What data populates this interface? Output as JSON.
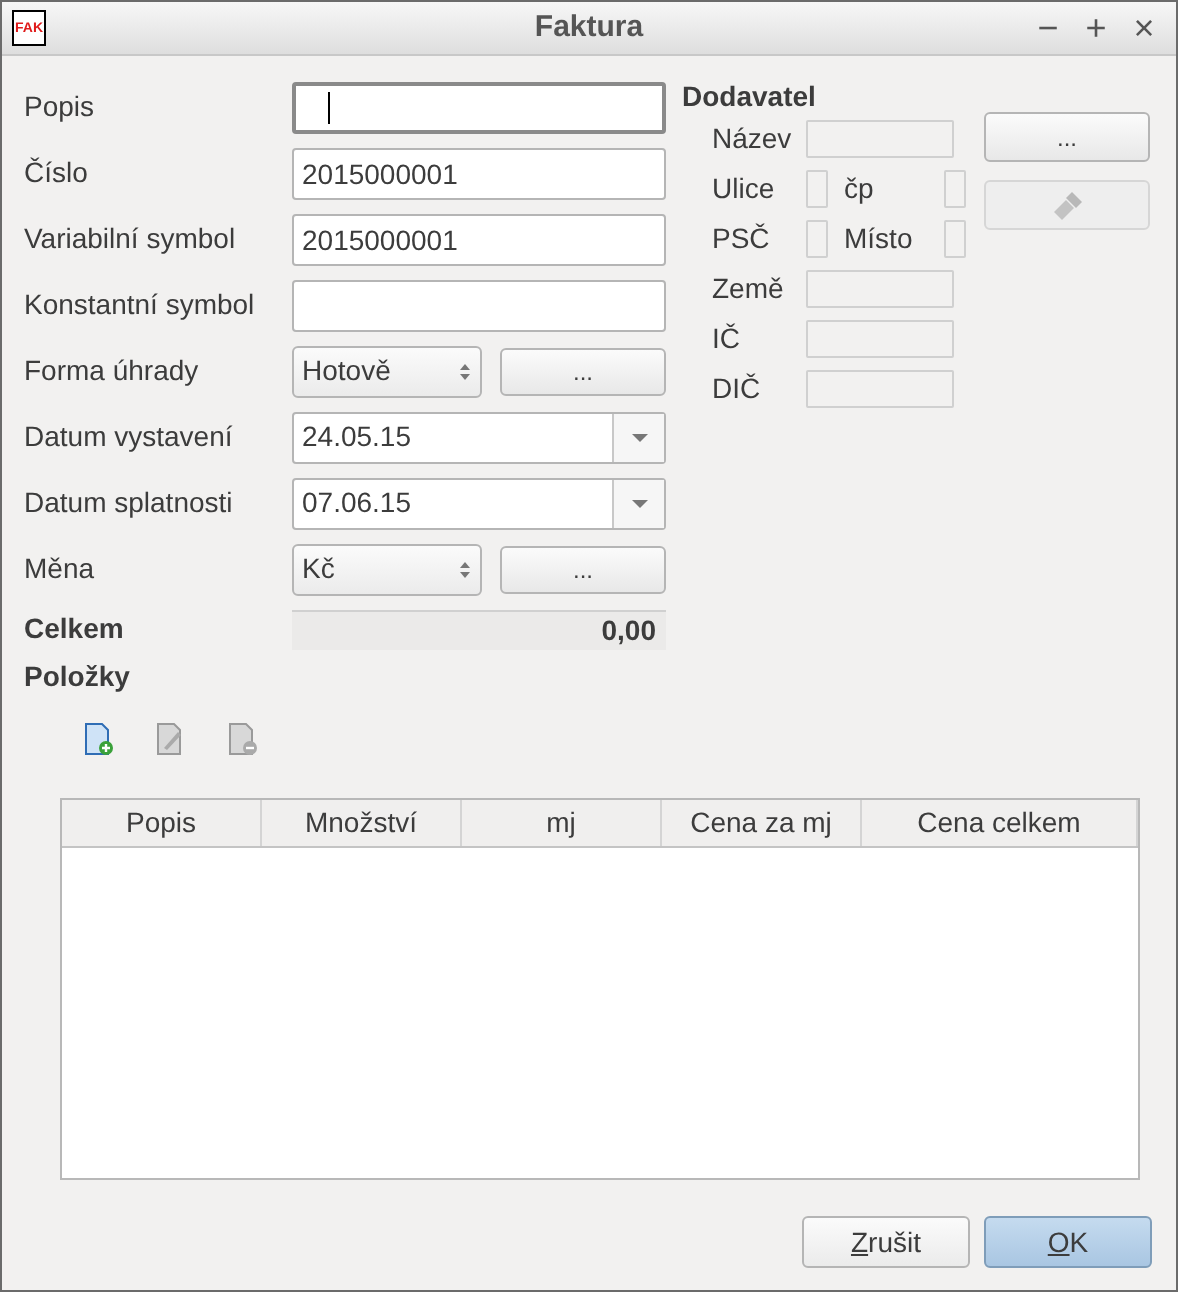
{
  "window": {
    "title": "Faktura",
    "app_icon_text": "FAK",
    "controls": [
      "−",
      "+",
      "×"
    ]
  },
  "form": [
    {
      "kind": "text",
      "label": "Popis",
      "focused": true
    },
    {
      "kind": "text",
      "label": "Číslo",
      "value": "2015000001",
      "focused": false
    },
    {
      "kind": "text",
      "label": "Variabilní symbol",
      "value": "2015000001",
      "focused": false
    },
    {
      "kind": "text",
      "label": "Konstantní symbol",
      "focused": false
    },
    {
      "kind": "combo",
      "label": "Forma úhrady",
      "value": "Hotově",
      "button": "..."
    },
    {
      "kind": "date",
      "label": "Datum vystavení",
      "value": "24.05.15"
    },
    {
      "kind": "date",
      "label": "Datum splatnosti",
      "value": "07.06.15"
    },
    {
      "kind": "combo",
      "label": "Měna",
      "value": "Kč",
      "button": "..."
    },
    {
      "kind": "total",
      "label": "Celkem",
      "value": "0,00"
    }
  ],
  "supplier": {
    "title": "Dodavatel",
    "rows": [
      {
        "kind": "single",
        "label": "Název"
      },
      {
        "kind": "pair",
        "label": "Ulice",
        "label_2": "čp"
      },
      {
        "kind": "pair",
        "label": "PSČ",
        "label_2": "Místo"
      },
      {
        "kind": "single",
        "label": "Země"
      },
      {
        "kind": "single",
        "label": "IČ"
      },
      {
        "kind": "single",
        "label": "DIČ"
      }
    ],
    "buttons": [
      {
        "kind": "text",
        "label": "...",
        "disabled": false
      },
      {
        "kind": "brush",
        "disabled": true
      }
    ]
  },
  "items": {
    "title": "Položky",
    "tools": [
      {
        "kind": "add",
        "disabled": false
      },
      {
        "kind": "edit",
        "disabled": true
      },
      {
        "kind": "remove",
        "disabled": true
      }
    ],
    "columns": [
      "Popis",
      "Množství",
      "mj",
      "Cena za mj",
      "Cena celkem"
    ]
  },
  "buttons": [
    {
      "label": "Zrušit",
      "default": false,
      "mnemonic_first": true
    },
    {
      "label": "OK",
      "default": true,
      "mnemonic_first": true
    }
  ]
}
